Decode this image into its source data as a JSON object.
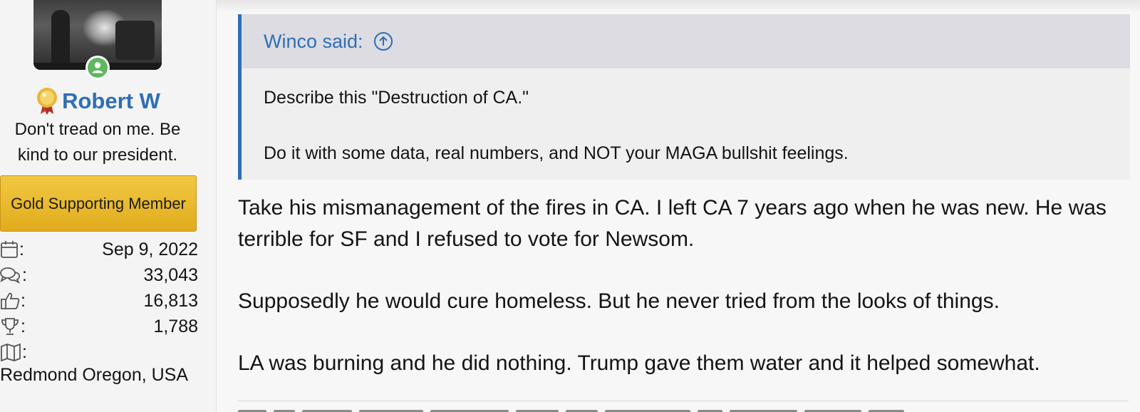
{
  "user": {
    "name": "Robert W",
    "title": "Don't tread on me. Be kind to our president.",
    "banner": "Gold Supporting Member",
    "stats": [
      {
        "icon": "calendar-icon",
        "value": "Sep 9, 2022"
      },
      {
        "icon": "messages-icon",
        "value": "33,043"
      },
      {
        "icon": "thumbs-up-icon",
        "value": "16,813"
      },
      {
        "icon": "trophy-icon",
        "value": "1,788"
      },
      {
        "icon": "map-icon",
        "value": ""
      }
    ],
    "colon": ":",
    "location": "Redmond Oregon, USA"
  },
  "quote": {
    "author": "Winco said:",
    "lines": [
      "Describe this \"Destruction of CA.\"",
      "Do it with some data, real numbers, and NOT your MAGA bullshit feelings."
    ]
  },
  "post": {
    "paragraphs": [
      "Take his mismanagement of the fires in CA. I left CA 7 years ago when he was new. He was terrible for SF and I refused to vote for Newsom.",
      "Supposedly he would cure homeless. But he never tried from the looks of things.",
      "LA was burning and he did nothing. Trump gave them water and it helped somewhat."
    ]
  },
  "colors": {
    "link_blue": "#2f6eb5",
    "banner_gold": "#e1ac1c",
    "online_green": "#5fb85f",
    "quote_bg": "#efefef",
    "quote_head_bg": "#dcdce2"
  }
}
